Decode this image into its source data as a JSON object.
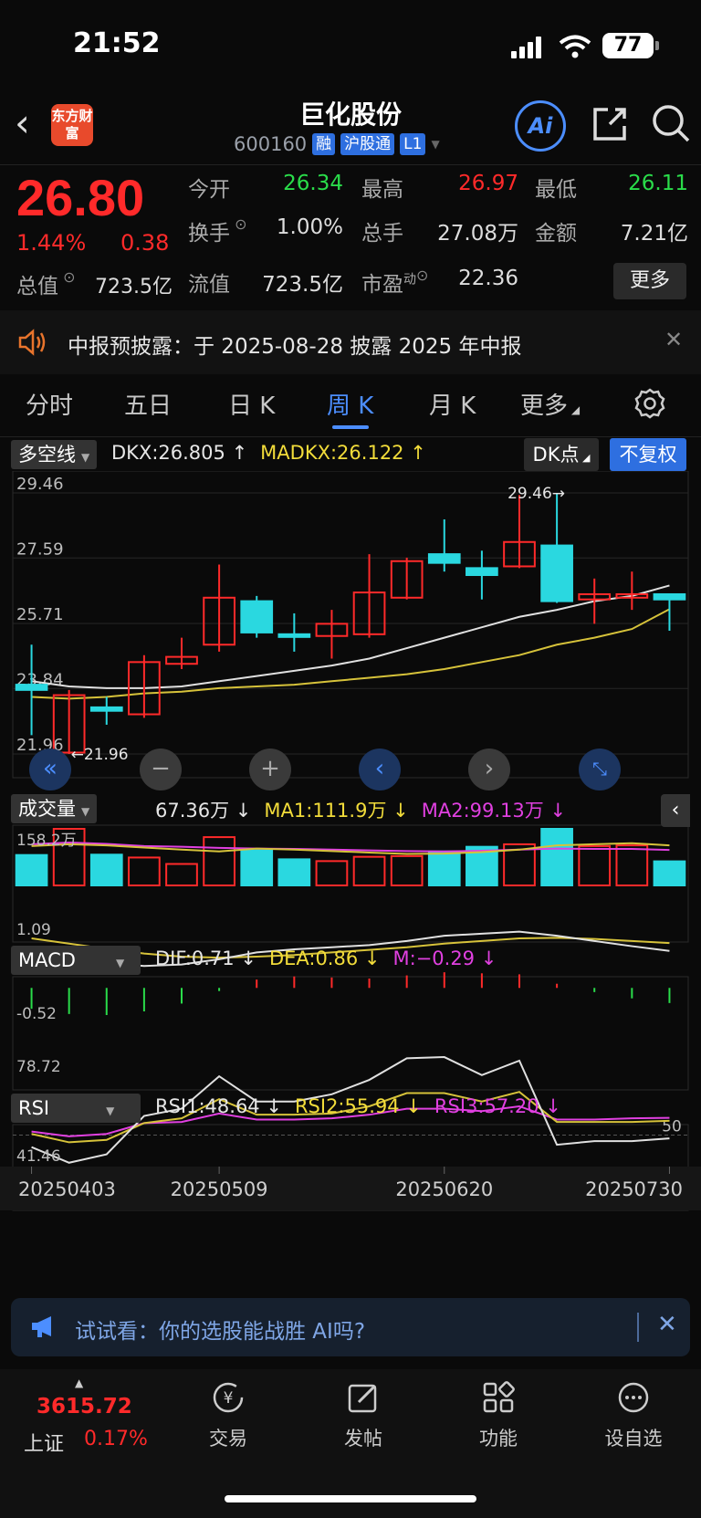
{
  "status": {
    "time": "21:52",
    "battery": "77"
  },
  "header": {
    "logo_text": "东方财富",
    "name": "巨化股份",
    "code": "600160",
    "tags": [
      "融",
      "沪股通",
      "L1"
    ],
    "ai_label": "Ai"
  },
  "quote": {
    "price": "26.80",
    "pct": "1.44%",
    "change": "0.38",
    "total_value_label": "总值",
    "total_value": "723.5亿",
    "open_label": "今开",
    "open": "26.34",
    "high_label": "最高",
    "high": "26.97",
    "low_label": "最低",
    "low": "26.11",
    "turnover_label": "换手",
    "turnover": "1.00%",
    "volume_label": "总手",
    "volume": "27.08万",
    "amount_label": "金额",
    "amount": "7.21亿",
    "float_label": "流值",
    "float_value": "723.5亿",
    "pe_label": "市盈",
    "pe_sup": "动",
    "pe": "22.36",
    "more_label": "更多"
  },
  "notice": {
    "text": "中报预披露：于 2025-08-28 披露 2025 年中报"
  },
  "tabs": [
    {
      "label": "分时"
    },
    {
      "label": "五日"
    },
    {
      "label": "日 K"
    },
    {
      "label": "周 K"
    },
    {
      "label": "月 K"
    },
    {
      "label": "更多"
    }
  ],
  "main_indicator": {
    "name": "多空线",
    "dkx": "DKX:26.805",
    "madkx": "MADKX:26.122",
    "dk_btn": "DK点",
    "fq_btn": "不复权"
  },
  "volume_indicator": {
    "name": "成交量",
    "v": "67.36万",
    "ma1": "MA1:111.9万",
    "ma2": "MA2:99.13万",
    "max_label": "158.2万"
  },
  "macd_indicator": {
    "name": "MACD",
    "dif": "DIF:0.71",
    "dea": "DEA:0.86",
    "m": "M:−0.29",
    "top_label": "1.09",
    "bottom_label": "-0.52"
  },
  "rsi_indicator": {
    "name": "RSI",
    "rsi1": "RSI1:48.64",
    "rsi2": "RSI2:55.94",
    "rsi3": "RSI3:57.20",
    "top_label": "78.72",
    "bottom_label": "41.46",
    "ref_label": "50"
  },
  "colors": {
    "up": "#ff2a2a",
    "down": "#2ad8e0",
    "dkx": "#e0e0e0",
    "madkx": "#d6c23a",
    "ma2": "#e040e0",
    "accent": "#4c8eff"
  },
  "chart_data": {
    "type": "candlestick",
    "y_axis_labels": [
      "29.46",
      "27.59",
      "25.71",
      "23.84",
      "21.96"
    ],
    "ylim": [
      21.96,
      29.46
    ],
    "x_tick_labels": [
      "20250403",
      "20250509",
      "20250620",
      "20250730"
    ],
    "annotations": [
      {
        "label": "29.46→",
        "value": 29.46
      },
      {
        "label": "←21.96",
        "value": 21.96
      }
    ],
    "candles": [
      {
        "o": 23.95,
        "c": 23.8,
        "h": 25.1,
        "l": 22.5
      },
      {
        "o": 22.0,
        "c": 23.65,
        "h": 23.8,
        "l": 21.96
      },
      {
        "o": 23.3,
        "c": 23.2,
        "h": 23.6,
        "l": 22.8
      },
      {
        "o": 23.1,
        "c": 24.6,
        "h": 24.8,
        "l": 23.0
      },
      {
        "o": 24.55,
        "c": 24.75,
        "h": 25.3,
        "l": 24.4
      },
      {
        "o": 25.1,
        "c": 26.45,
        "h": 27.4,
        "l": 24.9
      },
      {
        "o": 26.35,
        "c": 25.45,
        "h": 26.5,
        "l": 25.3
      },
      {
        "o": 25.4,
        "c": 25.35,
        "h": 26.0,
        "l": 24.9
      },
      {
        "o": 25.35,
        "c": 25.7,
        "h": 26.1,
        "l": 24.7
      },
      {
        "o": 25.4,
        "c": 26.6,
        "h": 27.7,
        "l": 25.3
      },
      {
        "o": 26.45,
        "c": 27.5,
        "h": 27.6,
        "l": 26.4
      },
      {
        "o": 27.7,
        "c": 27.45,
        "h": 28.7,
        "l": 27.2
      },
      {
        "o": 27.3,
        "c": 27.1,
        "h": 27.8,
        "l": 26.4
      },
      {
        "o": 27.35,
        "c": 28.05,
        "h": 29.4,
        "l": 27.3
      },
      {
        "o": 27.95,
        "c": 26.35,
        "h": 29.46,
        "l": 26.3
      },
      {
        "o": 26.4,
        "c": 26.55,
        "h": 27.0,
        "l": 25.7
      },
      {
        "o": 26.45,
        "c": 26.55,
        "h": 27.2,
        "l": 26.1
      },
      {
        "o": 26.55,
        "c": 26.4,
        "h": 26.55,
        "l": 25.5
      }
    ],
    "dkx": [
      24.05,
      23.9,
      23.85,
      23.85,
      23.9,
      24.05,
      24.2,
      24.35,
      24.5,
      24.7,
      25.0,
      25.3,
      25.6,
      25.9,
      26.1,
      26.35,
      26.5,
      26.8
    ],
    "madkx": [
      23.6,
      23.55,
      23.6,
      23.7,
      23.75,
      23.85,
      23.9,
      23.95,
      24.05,
      24.15,
      24.25,
      24.4,
      24.6,
      24.8,
      25.1,
      25.3,
      25.55,
      26.12
    ],
    "volume": {
      "ylim": [
        0,
        158.2
      ],
      "values": [
        85,
        158.2,
        86,
        78,
        60,
        135,
        98,
        73,
        68,
        80,
        82,
        95,
        108,
        115,
        158.2,
        110,
        112,
        67.36
      ],
      "ma1": [
        110,
        115,
        112,
        106,
        100,
        95,
        103,
        100,
        96,
        92,
        88,
        89,
        93,
        100,
        112,
        115,
        118,
        111.9
      ],
      "ma2": [
        115,
        120,
        116,
        110,
        108,
        105,
        103,
        102,
        100,
        98,
        96,
        95,
        97,
        100,
        103,
        102,
        102,
        99.13
      ]
    },
    "macd": {
      "ylim": [
        -0.52,
        1.09
      ],
      "dif": [
        0.75,
        0.6,
        0.48,
        0.42,
        0.45,
        0.55,
        0.68,
        0.74,
        0.78,
        0.82,
        0.9,
        1.0,
        1.04,
        1.08,
        1.0,
        0.9,
        0.8,
        0.71
      ],
      "dea": [
        0.95,
        0.85,
        0.75,
        0.66,
        0.6,
        0.58,
        0.6,
        0.63,
        0.68,
        0.73,
        0.78,
        0.85,
        0.9,
        0.95,
        0.96,
        0.94,
        0.9,
        0.86
      ],
      "m": [
        -0.4,
        -0.5,
        -0.52,
        -0.45,
        -0.3,
        -0.06,
        0.16,
        0.22,
        0.2,
        0.18,
        0.24,
        0.3,
        0.28,
        0.26,
        0.08,
        -0.08,
        -0.2,
        -0.29
      ]
    },
    "rsi": {
      "ylim": [
        41.46,
        78.72
      ],
      "rsi1": [
        45,
        38.5,
        42,
        58,
        61,
        74.5,
        64,
        64,
        67,
        73,
        82,
        82.5,
        75,
        81,
        46,
        47.5,
        47.5,
        48.64
      ],
      "rsi2": [
        50.5,
        47,
        48,
        55,
        57,
        65,
        58.5,
        58.5,
        59,
        62,
        67.5,
        67.5,
        64,
        68,
        55.5,
        55.5,
        55.5,
        55.94
      ],
      "rsi3": [
        51.5,
        49.5,
        50.5,
        55,
        55.5,
        59,
        56.5,
        56.5,
        57,
        58.5,
        61,
        61,
        60,
        62,
        56.5,
        56.5,
        57,
        57.2
      ],
      "ref": 50
    }
  },
  "promo": {
    "text": "试试看：你的选股能战胜 AI吗?"
  },
  "bottom_nav": {
    "index_value": "3615.72",
    "index_name": "上证",
    "index_pct": "0.17%",
    "items": [
      {
        "label": "交易"
      },
      {
        "label": "发帖"
      },
      {
        "label": "功能"
      },
      {
        "label": "设自选"
      }
    ]
  }
}
